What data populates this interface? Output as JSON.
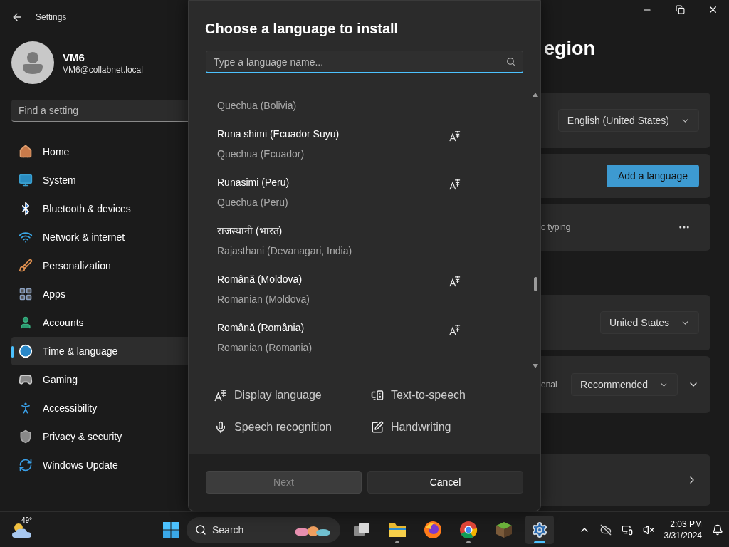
{
  "window": {
    "title": "Settings"
  },
  "user": {
    "name": "VM6",
    "email": "VM6@collabnet.local"
  },
  "sidebar": {
    "search": {
      "placeholder": "Find a setting"
    },
    "items": [
      {
        "kind": "home",
        "label": "Home",
        "selected": false
      },
      {
        "kind": "system",
        "label": "System",
        "selected": false
      },
      {
        "kind": "bluetooth",
        "label": "Bluetooth & devices",
        "selected": false
      },
      {
        "kind": "network",
        "label": "Network & internet",
        "selected": false
      },
      {
        "kind": "personalization",
        "label": "Personalization",
        "selected": false
      },
      {
        "kind": "apps",
        "label": "Apps",
        "selected": false
      },
      {
        "kind": "accounts",
        "label": "Accounts",
        "selected": false
      },
      {
        "kind": "time",
        "label": "Time & language",
        "selected": true
      },
      {
        "kind": "gaming",
        "label": "Gaming",
        "selected": false
      },
      {
        "kind": "accessibility",
        "label": "Accessibility",
        "selected": false
      },
      {
        "kind": "privacy",
        "label": "Privacy & security",
        "selected": false
      },
      {
        "kind": "update",
        "label": "Windows Update",
        "selected": false
      }
    ]
  },
  "page": {
    "title": "egion",
    "cards": [
      {
        "kind": "dropdown",
        "value": "English (United States)"
      },
      {
        "kind": "button",
        "label": "Add a language"
      },
      {
        "kind": "more",
        "text": "c typing"
      },
      {
        "kind": "dropdown",
        "value": "United States"
      },
      {
        "kind": "dropdown_expand",
        "text": "enal",
        "value": "Recommended"
      },
      {
        "kind": "link"
      }
    ]
  },
  "dialog": {
    "title": "Choose a language to install",
    "search": {
      "placeholder": "Type a language name..."
    },
    "languages": [
      {
        "subtitle": "Quechua (Bolivia)",
        "display_language": false
      },
      {
        "name": "Runa shimi (Ecuador Suyu)",
        "subtitle": "Quechua (Ecuador)",
        "display_language": true
      },
      {
        "name": "Runasimi (Peru)",
        "subtitle": "Quechua (Peru)",
        "display_language": true
      },
      {
        "name": "राजस्थानी (भारत)",
        "subtitle": "Rajasthani (Devanagari, India)",
        "display_language": false
      },
      {
        "name": "Română (Moldova)",
        "subtitle": "Romanian (Moldova)",
        "display_language": true
      },
      {
        "name": "Română (România)",
        "subtitle": "Romanian (Romania)",
        "display_language": true
      }
    ],
    "legend": [
      {
        "kind": "display",
        "label": "Display language"
      },
      {
        "kind": "tts",
        "label": "Text-to-speech"
      },
      {
        "kind": "speech",
        "label": "Speech recognition"
      },
      {
        "kind": "handwriting",
        "label": "Handwriting"
      }
    ],
    "buttons": [
      {
        "label": "Next",
        "disabled": true
      },
      {
        "label": "Cancel",
        "disabled": false
      }
    ]
  },
  "taskbar": {
    "weather": "49°",
    "search": {
      "placeholder": "Search"
    },
    "apps": [
      {
        "kind": "taskview",
        "running": false,
        "active": false
      },
      {
        "kind": "explorer",
        "running": true,
        "active": false
      },
      {
        "kind": "firefox",
        "running": false,
        "active": false
      },
      {
        "kind": "chrome",
        "running": true,
        "active": false
      },
      {
        "kind": "minecraft",
        "running": false,
        "active": false
      },
      {
        "kind": "settings",
        "running": true,
        "active": true
      }
    ],
    "time": "2:03 PM",
    "date": "3/31/2024"
  }
}
